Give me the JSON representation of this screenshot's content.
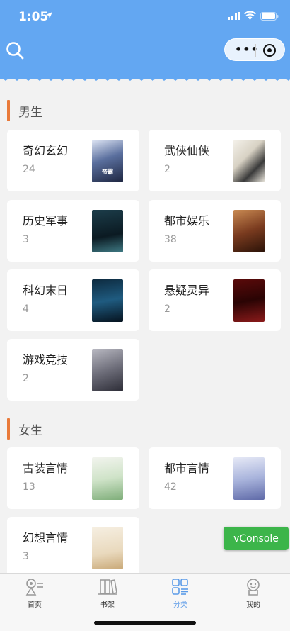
{
  "status_bar": {
    "time": "1:05"
  },
  "sections": [
    {
      "title": "男生",
      "categories": [
        {
          "name": "奇幻玄幻",
          "count": "24",
          "cover_text": "帝霸"
        },
        {
          "name": "武侠仙侠",
          "count": "2",
          "cover_text": ""
        },
        {
          "name": "历史军事",
          "count": "3",
          "cover_text": ""
        },
        {
          "name": "都市娱乐",
          "count": "38",
          "cover_text": ""
        },
        {
          "name": "科幻末日",
          "count": "4",
          "cover_text": ""
        },
        {
          "name": "悬疑灵异",
          "count": "2",
          "cover_text": ""
        },
        {
          "name": "游戏竞技",
          "count": "2",
          "cover_text": ""
        }
      ]
    },
    {
      "title": "女生",
      "categories": [
        {
          "name": "古装言情",
          "count": "13",
          "cover_text": ""
        },
        {
          "name": "都市言情",
          "count": "42",
          "cover_text": ""
        },
        {
          "name": "幻想言情",
          "count": "3",
          "cover_text": ""
        }
      ]
    }
  ],
  "vconsole_label": "vConsole",
  "tabs": [
    {
      "label": "首页",
      "icon": "home-icon"
    },
    {
      "label": "书架",
      "icon": "bookshelf-icon"
    },
    {
      "label": "分类",
      "icon": "category-icon",
      "active": true
    },
    {
      "label": "我的",
      "icon": "profile-icon"
    }
  ],
  "colors": {
    "header": "#63a7f2",
    "accent_bar": "#e97a3a",
    "active_tab": "#5b9be8",
    "vconsole": "#3cb54a"
  }
}
